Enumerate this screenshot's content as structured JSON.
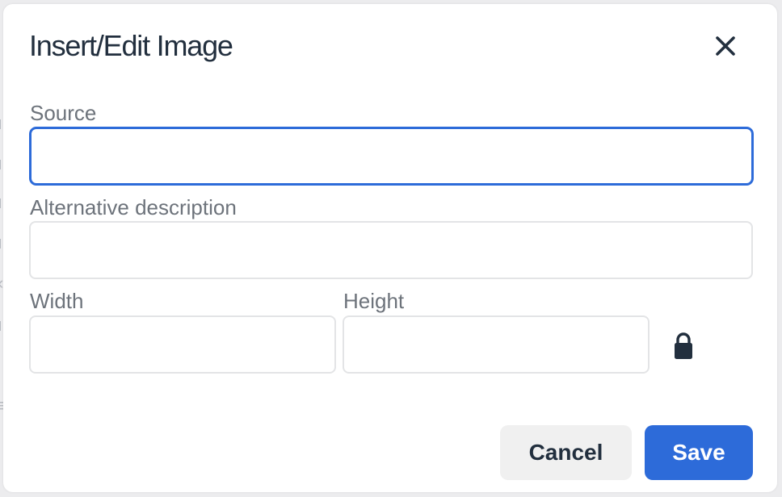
{
  "dialog": {
    "title": "Insert/Edit Image",
    "close_icon": "close-icon"
  },
  "fields": {
    "source": {
      "label": "Source",
      "value": "",
      "placeholder": ""
    },
    "alt": {
      "label": "Alternative description",
      "value": "",
      "placeholder": ""
    },
    "width": {
      "label": "Width",
      "value": "",
      "placeholder": ""
    },
    "height": {
      "label": "Height",
      "value": "",
      "placeholder": ""
    }
  },
  "constrain_proportions_icon": "lock-icon",
  "buttons": {
    "cancel_label": "Cancel",
    "save_label": "Save"
  },
  "colors": {
    "accent": "#2d6bd9",
    "text": "#222f3e",
    "label": "#6d737b",
    "border": "#e3e4e6",
    "cancel_bg": "#f0f0f0"
  }
}
